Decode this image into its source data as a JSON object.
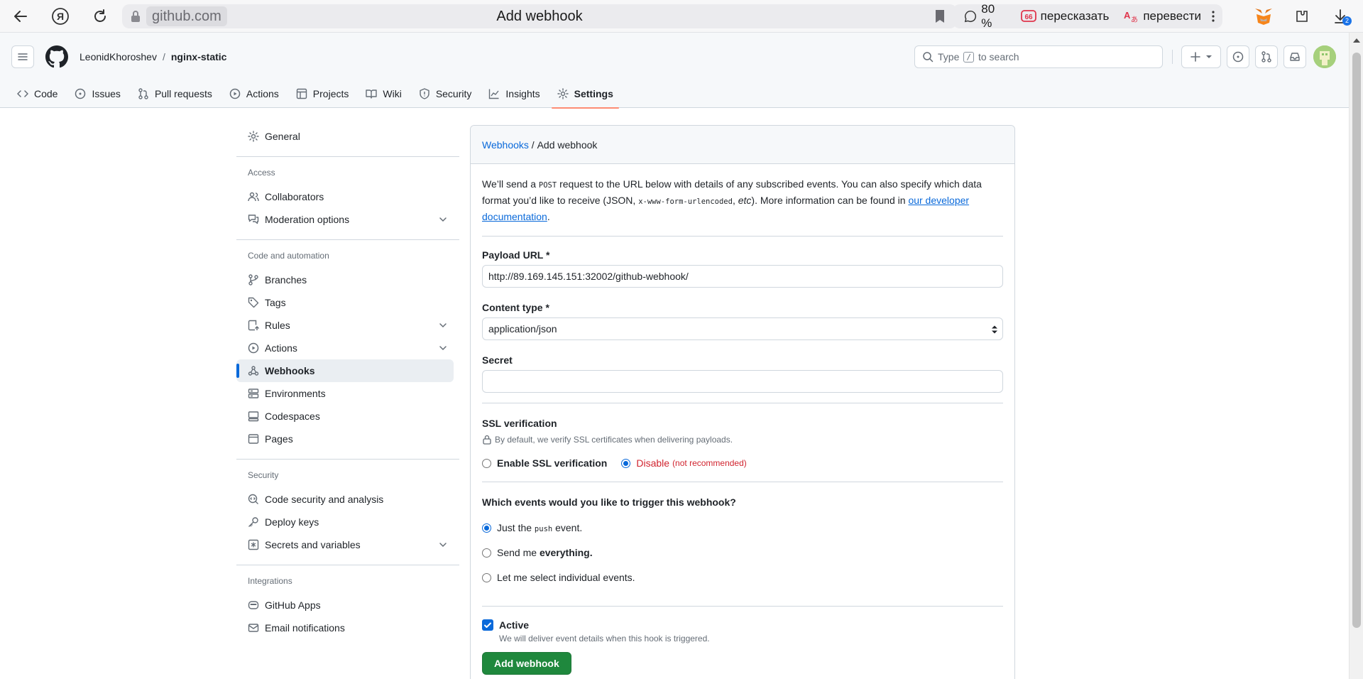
{
  "browser": {
    "domain": "github.com",
    "page_title": "Add webhook",
    "zoom": "80 %",
    "summarize_label": "пересказать",
    "translate_label": "перевести",
    "downloads_badge": "2"
  },
  "header": {
    "owner": "LeonidKhoroshev",
    "separator": "/",
    "repo": "nginx-static",
    "search_type": "Type",
    "search_key": "/",
    "search_rest": "to search"
  },
  "repo_nav": {
    "code": "Code",
    "issues": "Issues",
    "pull_requests": "Pull requests",
    "actions": "Actions",
    "projects": "Projects",
    "wiki": "Wiki",
    "security": "Security",
    "insights": "Insights",
    "settings": "Settings"
  },
  "sidebar": {
    "general": "General",
    "access_title": "Access",
    "collaborators": "Collaborators",
    "moderation": "Moderation options",
    "code_title": "Code and automation",
    "branches": "Branches",
    "tags": "Tags",
    "rules": "Rules",
    "actions": "Actions",
    "webhooks": "Webhooks",
    "environments": "Environments",
    "codespaces": "Codespaces",
    "pages": "Pages",
    "security_title": "Security",
    "code_security": "Code security and analysis",
    "deploy_keys": "Deploy keys",
    "secrets": "Secrets and variables",
    "integrations_title": "Integrations",
    "github_apps": "GitHub Apps",
    "email_notifications": "Email notifications"
  },
  "form": {
    "breadcrumb_link": "Webhooks",
    "breadcrumb_sep": " / ",
    "breadcrumb_current": "Add webhook",
    "intro_1": "We’ll send a ",
    "intro_post": "POST",
    "intro_2": " request to the URL below with details of any subscribed events. You can also specify which data format you’d like to receive (JSON, ",
    "intro_code": "x-www-form-urlencoded",
    "intro_comma": ", ",
    "intro_etc": "etc",
    "intro_3": "). More information can be found in ",
    "intro_link": "our developer documentation",
    "intro_end": ".",
    "payload_label": "Payload URL *",
    "payload_value": "http://89.169.145.151:32002/github-webhook/",
    "content_type_label": "Content type *",
    "content_type_value": "application/json",
    "secret_label": "Secret",
    "secret_value": "",
    "ssl_label": "SSL verification",
    "ssl_note": "By default, we verify SSL certificates when delivering payloads.",
    "ssl_enable": "Enable SSL verification",
    "ssl_disable": "Disable",
    "ssl_disable_note": "(not recommended)",
    "events_label": "Which events would you like to trigger this webhook?",
    "event_push_1": "Just the ",
    "event_push_code": "push",
    "event_push_2": " event.",
    "event_all_1": "Send me ",
    "event_all_2": "everything.",
    "event_select": "Let me select individual events.",
    "active_label": "Active",
    "active_note": "We will deliver event details when this hook is triggered.",
    "submit_label": "Add webhook"
  },
  "colors": {
    "accent_blue": "#0969da",
    "primary_green": "#1f883d",
    "danger_red": "#d1242f",
    "tab_underline": "#fd8c73"
  }
}
